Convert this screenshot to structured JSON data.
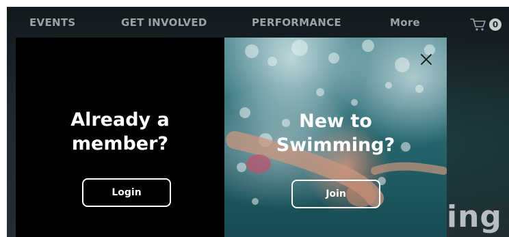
{
  "nav": {
    "items": [
      {
        "label": "EVENTS"
      },
      {
        "label": "GET INVOLVED"
      },
      {
        "label": "PERFORMANCE"
      },
      {
        "label": "More"
      }
    ],
    "cart": {
      "icon": "cart-icon",
      "count": "0"
    }
  },
  "background": {
    "heading_fragment": "ing t"
  },
  "modal": {
    "close_icon": "close-icon",
    "member": {
      "title_line1": "Already a",
      "title_line2": "member?",
      "button_label": "Login"
    },
    "newcomer": {
      "title_line1": "New to",
      "title_line2": "Swimming?",
      "button_label": "Join"
    }
  },
  "colors": {
    "modal_left_bg": "#000000",
    "text": "#ffffff",
    "nav_text": "#9aa3a6"
  }
}
